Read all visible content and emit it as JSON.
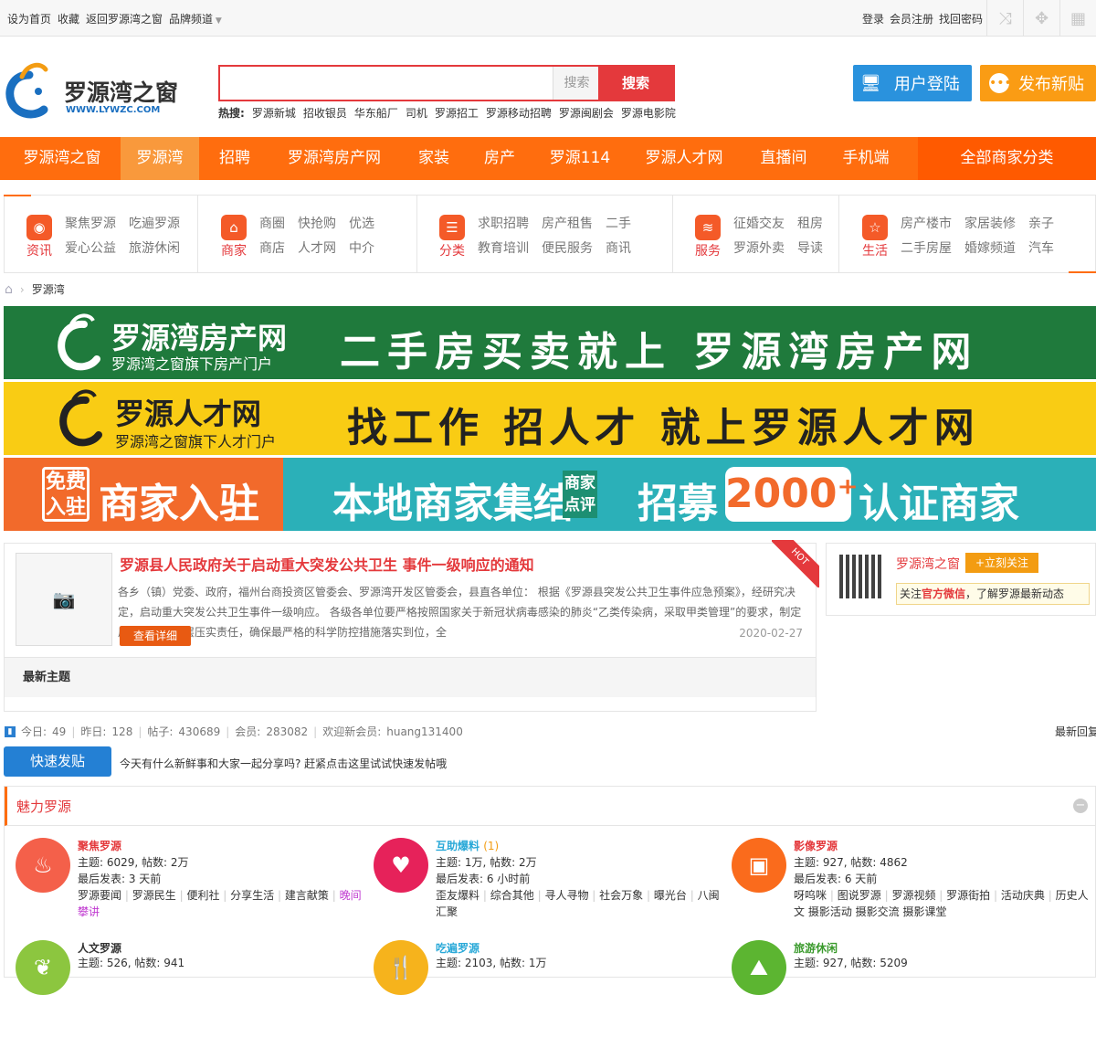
{
  "topbar": {
    "left_links": [
      "设为首页",
      "收藏",
      "返回罗源湾之窗",
      "品牌频道"
    ],
    "right_links": [
      "登录",
      "会员注册",
      "找回密码"
    ]
  },
  "logo": {
    "title": "罗源湾之窗",
    "url_text": "WWW.LYWZC.COM"
  },
  "search": {
    "placeholder": "",
    "select_label": "搜索",
    "button_label": "搜索"
  },
  "hotwords": {
    "label": "热搜:",
    "items": [
      "罗源新城",
      "招收银员",
      "华东船厂",
      "司机",
      "罗源招工",
      "罗源移动招聘",
      "罗源闽剧会",
      "罗源电影院"
    ]
  },
  "header_buttons": {
    "login": "用户登陆",
    "post": "发布新贴"
  },
  "nav": {
    "items": [
      "罗源湾之窗",
      "罗源湾",
      "招聘",
      "罗源湾房产网",
      "家装",
      "房产",
      "罗源114",
      "罗源人才网",
      "直播间",
      "手机端"
    ],
    "all_label": "全部商家分类",
    "accent": "#ff6d0e"
  },
  "categories": [
    {
      "label": "资讯",
      "icon": "globe-icon",
      "links": [
        "聚焦罗源",
        "吃遍罗源",
        "爱心公益",
        "旅游休闲"
      ]
    },
    {
      "label": "商家",
      "icon": "home-icon",
      "links": [
        "商圈",
        "快抢购",
        "优选",
        "商店",
        "人才网",
        "中介"
      ]
    },
    {
      "label": "分类",
      "icon": "grid-icon",
      "links": [
        "求职招聘",
        "房产租售",
        "二手",
        "教育培训",
        "便民服务",
        "商讯"
      ]
    },
    {
      "label": "服务",
      "icon": "layers-icon",
      "links": [
        "征婚交友",
        "租房",
        "罗源外卖",
        "导读"
      ]
    },
    {
      "label": "生活",
      "icon": "star-icon",
      "links": [
        "房产楼市",
        "家居装修",
        "亲子",
        "二手房屋",
        "婚嫁频道",
        "汽车"
      ]
    }
  ],
  "breadcrumb": {
    "current": "罗源湾"
  },
  "banners": [
    {
      "brand": "罗源湾房产网",
      "sub": "罗源湾之窗旗下房产门户",
      "slogan": "二手房买卖就上 罗源湾房产网"
    },
    {
      "brand": "罗源人才网",
      "sub": "罗源湾之窗旗下人才门户",
      "slogan": "找工作 招人才 就上罗源人才网"
    },
    {
      "badge": "免费入驻",
      "brand": "商家入驻",
      "slogan1": "本地商家集结",
      "tag": "商家点评",
      "slogan2": "招募",
      "count": "2000⁺",
      "slogan3": "认证商家"
    }
  ],
  "news": {
    "title": "罗源县人民政府关于启动重大突发公共卫生 事件一级响应的通知",
    "body": "各乡（镇）党委、政府，福州台商投资区管委会、罗源湾开发区管委会，县直各单位： 根据《罗源县突发公共卫生事件应急预案》，经研究决定，启动重大突发公共卫生事件一级响应。 各级各单位要严格按照国家关于新冠状病毒感染的肺炎“乙类传染病，采取甲类管理”的要求，制定周密方案，层层压实责任，确保最严格的科学防控措施落实到位，全",
    "more": "查看详细",
    "date": "2020-02-27",
    "hot": "HOT",
    "latest": "最新主题"
  },
  "wechat": {
    "name": "罗源湾之窗",
    "follow": "+立刻关注",
    "tip_pre": "关注",
    "tip_em": "官方微信",
    "tip_post": "，了解罗源最新动态"
  },
  "stats": {
    "today_label": "今日:",
    "today": "49",
    "yesterday_label": "昨日:",
    "yesterday": "128",
    "posts_label": "帖子:",
    "posts": "430689",
    "members_label": "会员:",
    "members": "283082",
    "welcome_label": "欢迎新会员:",
    "welcome": "huang131400",
    "last_reply": "最新回复"
  },
  "quickpost": {
    "button": "快速发贴",
    "tip": "今天有什么新鲜事和大家一起分享吗? 赶紧点击这里试试快速发帖哦"
  },
  "forum": {
    "title": "魅力罗源",
    "boards": [
      {
        "name": "聚焦罗源",
        "color": "#f4604a",
        "name_color": "#e4393c",
        "extra": "",
        "stats": "主题: 6029, 帖数: 2万",
        "last": "最后发表: 3 天前",
        "subs": [
          "罗源要闻",
          "罗源民生",
          "便利社",
          "分享生活",
          "建言献策"
        ],
        "tail": "晚间攀讲"
      },
      {
        "name": "互助爆料",
        "color": "#e6225a",
        "name_color": "#2aa9d8",
        "extra": "(1)",
        "stats": "主题: 1万, 帖数: 2万",
        "last": "最后发表: 6 小时前",
        "subs": [
          "歪友爆料",
          "综合其他",
          "寻人寻物",
          "社会万象",
          "曝光台"
        ],
        "tail": "八闽汇聚"
      },
      {
        "name": "影像罗源",
        "color": "#fa6b1c",
        "name_color": "#e4393c",
        "extra": "",
        "stats": "主题: 927, 帖数: 4862",
        "last": "最后发表: 6 天前",
        "subs": [
          "呀呜咪",
          "图说罗源",
          "罗源视频",
          "罗源街拍",
          "活动庆典"
        ],
        "tail": "历史人文 摄影活动 摄影交流 摄影课堂"
      },
      {
        "name": "人文罗源",
        "color": "#8cc63f",
        "name_color": "#333",
        "extra": "",
        "stats": "主题: 526, 帖数: 941",
        "last": "",
        "subs": [],
        "tail": ""
      },
      {
        "name": "吃遍罗源",
        "color": "#f6b31c",
        "name_color": "#2aa9d8",
        "extra": "",
        "stats": "主题: 2103, 帖数: 1万",
        "last": "",
        "subs": [],
        "tail": ""
      },
      {
        "name": "旅游休闲",
        "color": "#5cb531",
        "name_color": "#3a9a2c",
        "extra": "",
        "stats": "主题: 927, 帖数: 5209",
        "last": "",
        "subs": [],
        "tail": ""
      }
    ]
  }
}
